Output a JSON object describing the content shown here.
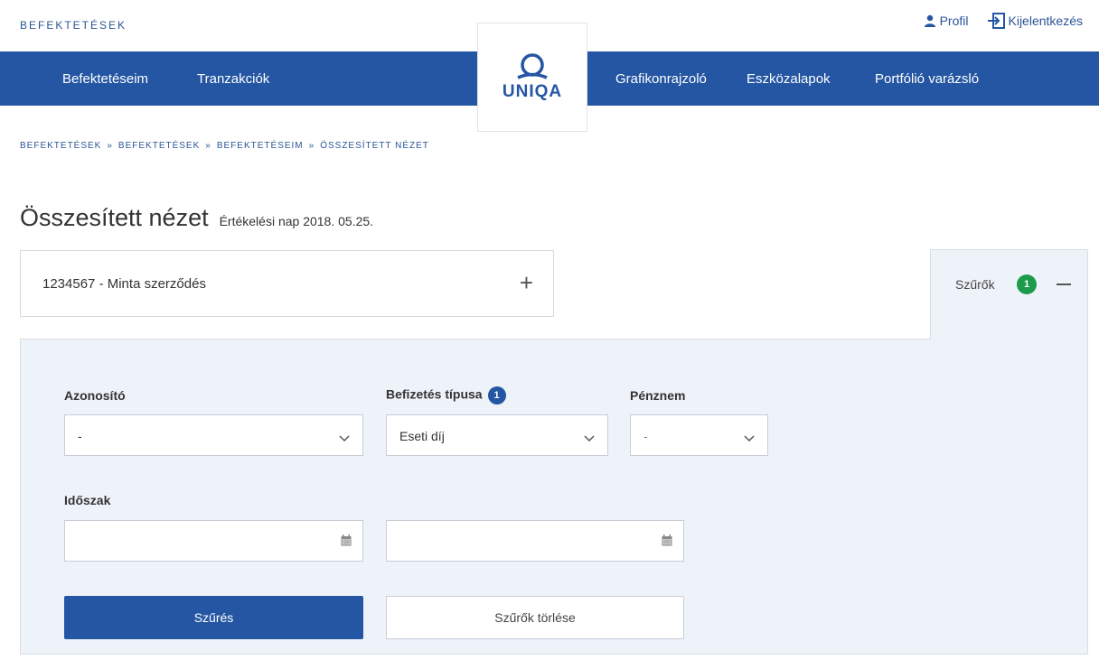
{
  "header": {
    "section": "BEFEKTETÉSEK",
    "profile_label": "Profil",
    "logout_label": "Kijelentkezés",
    "logo_text": "UNIQA"
  },
  "nav": {
    "items": [
      "Befektetéseim",
      "Tranzakciók",
      "Grafikonrajzoló",
      "Eszközalapok",
      "Portfólió varázsló"
    ]
  },
  "breadcrumb": [
    "BEFEKTETÉSEK",
    "BEFEKTETÉSEK",
    "BEFEKTETÉSEIM",
    "ÖSSZESÍTETT NÉZET"
  ],
  "breadcrumb_separator": "»",
  "page": {
    "title": "Összesített nézet",
    "subtitle": "Értékelési nap 2018. 05.25."
  },
  "contract": {
    "label": "1234567 - Minta szerződés",
    "expand_symbol": "+"
  },
  "filters_tab": {
    "label": "Szűrők",
    "count": "1"
  },
  "filters": {
    "id_label": "Azonosító",
    "id_value": "-",
    "payment_type_label": "Befizetés típusa",
    "payment_type_count": "1",
    "payment_type_value": "Eseti díj",
    "currency_label": "Pénznem",
    "currency_value": "-",
    "period_label": "Időszak",
    "period_from": "",
    "period_to": "",
    "submit_label": "Szűrés",
    "clear_label": "Szűrők törlése"
  },
  "colors": {
    "brand_blue": "#2456a3",
    "panel_bg": "#eef3fa",
    "success_green": "#1c9b4c"
  },
  "icons": [
    "person-icon",
    "logout-icon",
    "uniqa-logo",
    "plus-icon",
    "minus-icon",
    "chevron-down-icon",
    "calendar-icon"
  ]
}
